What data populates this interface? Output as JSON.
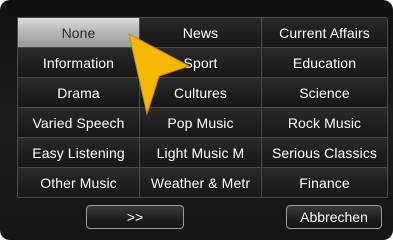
{
  "genre_grid": {
    "cells": [
      "None",
      "News",
      "Current Affairs",
      "Information",
      "Sport",
      "Education",
      "Drama",
      "Cultures",
      "Science",
      "Varied Speech",
      "Pop Music",
      "Rock Music",
      "Easy Listening",
      "Light Music M",
      "Serious Classics",
      "Other Music",
      "Weather & Metr",
      "Finance"
    ],
    "selected": "None"
  },
  "buttons": {
    "next_label": ">>",
    "cancel_label": "Abbrechen"
  },
  "colors": {
    "cursor": "#f5b800",
    "selected_cell": "#c8c8c8",
    "background": "#161616"
  },
  "icons": {
    "pointer": "arrow-pointer-icon"
  }
}
